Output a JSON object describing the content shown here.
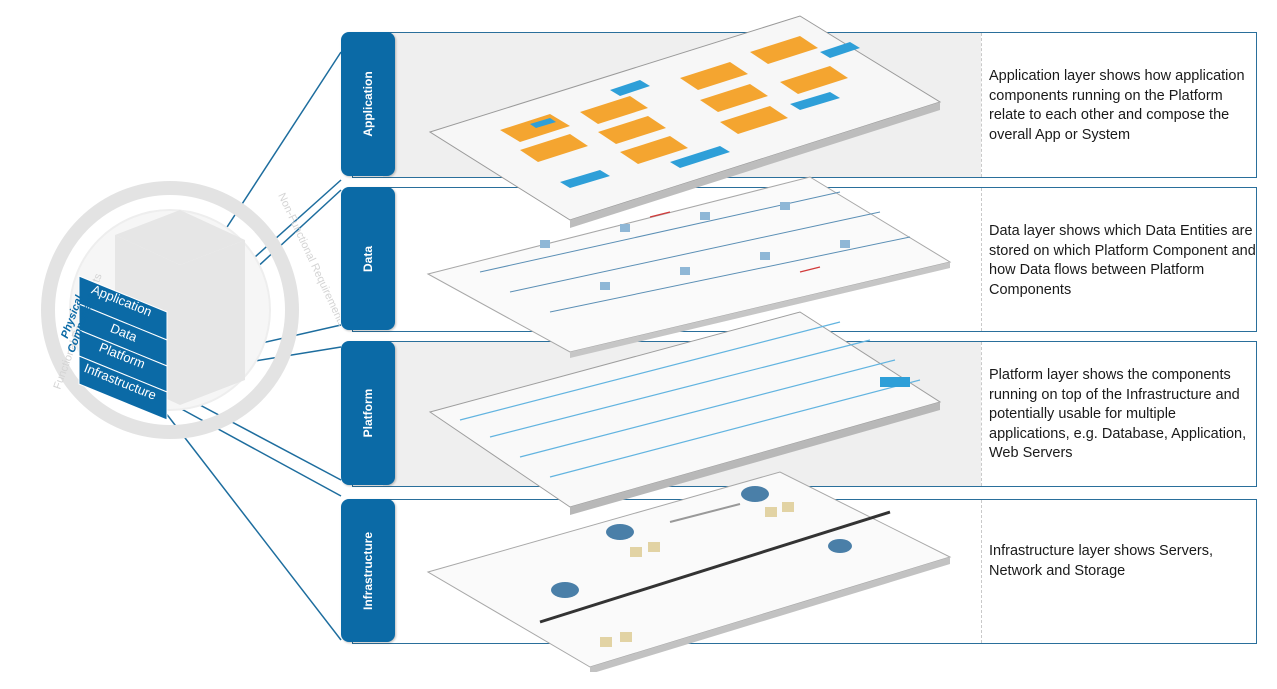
{
  "cube": {
    "title": "Physical Components",
    "layers": [
      "Application",
      "Data",
      "Platform",
      "Infrastructure"
    ],
    "ring_text_left": "Functional Requirements",
    "ring_text_right": "Non-Functional Requirements & Qualities"
  },
  "layers": [
    {
      "tab": "Application",
      "description": "Application layer shows how application components running on the Platform relate to each other and compose the overall App or System"
    },
    {
      "tab": "Data",
      "description": "Data layer shows which Data Entities are stored on which Platform Component and how Data flows between Platform Components"
    },
    {
      "tab": "Platform",
      "description": "Platform layer shows the components running on top of the Infrastructure and potentially usable for multiple applications, e.g. Database, Application, Web Servers"
    },
    {
      "tab": "Infrastructure",
      "description": "Infrastructure layer shows Servers, Network and Storage"
    }
  ],
  "colors": {
    "tab_blue": "#0b6aa6",
    "panel_border": "#2a6f9b",
    "orange": "#f4a530",
    "light_blue": "#2e9fd8"
  }
}
